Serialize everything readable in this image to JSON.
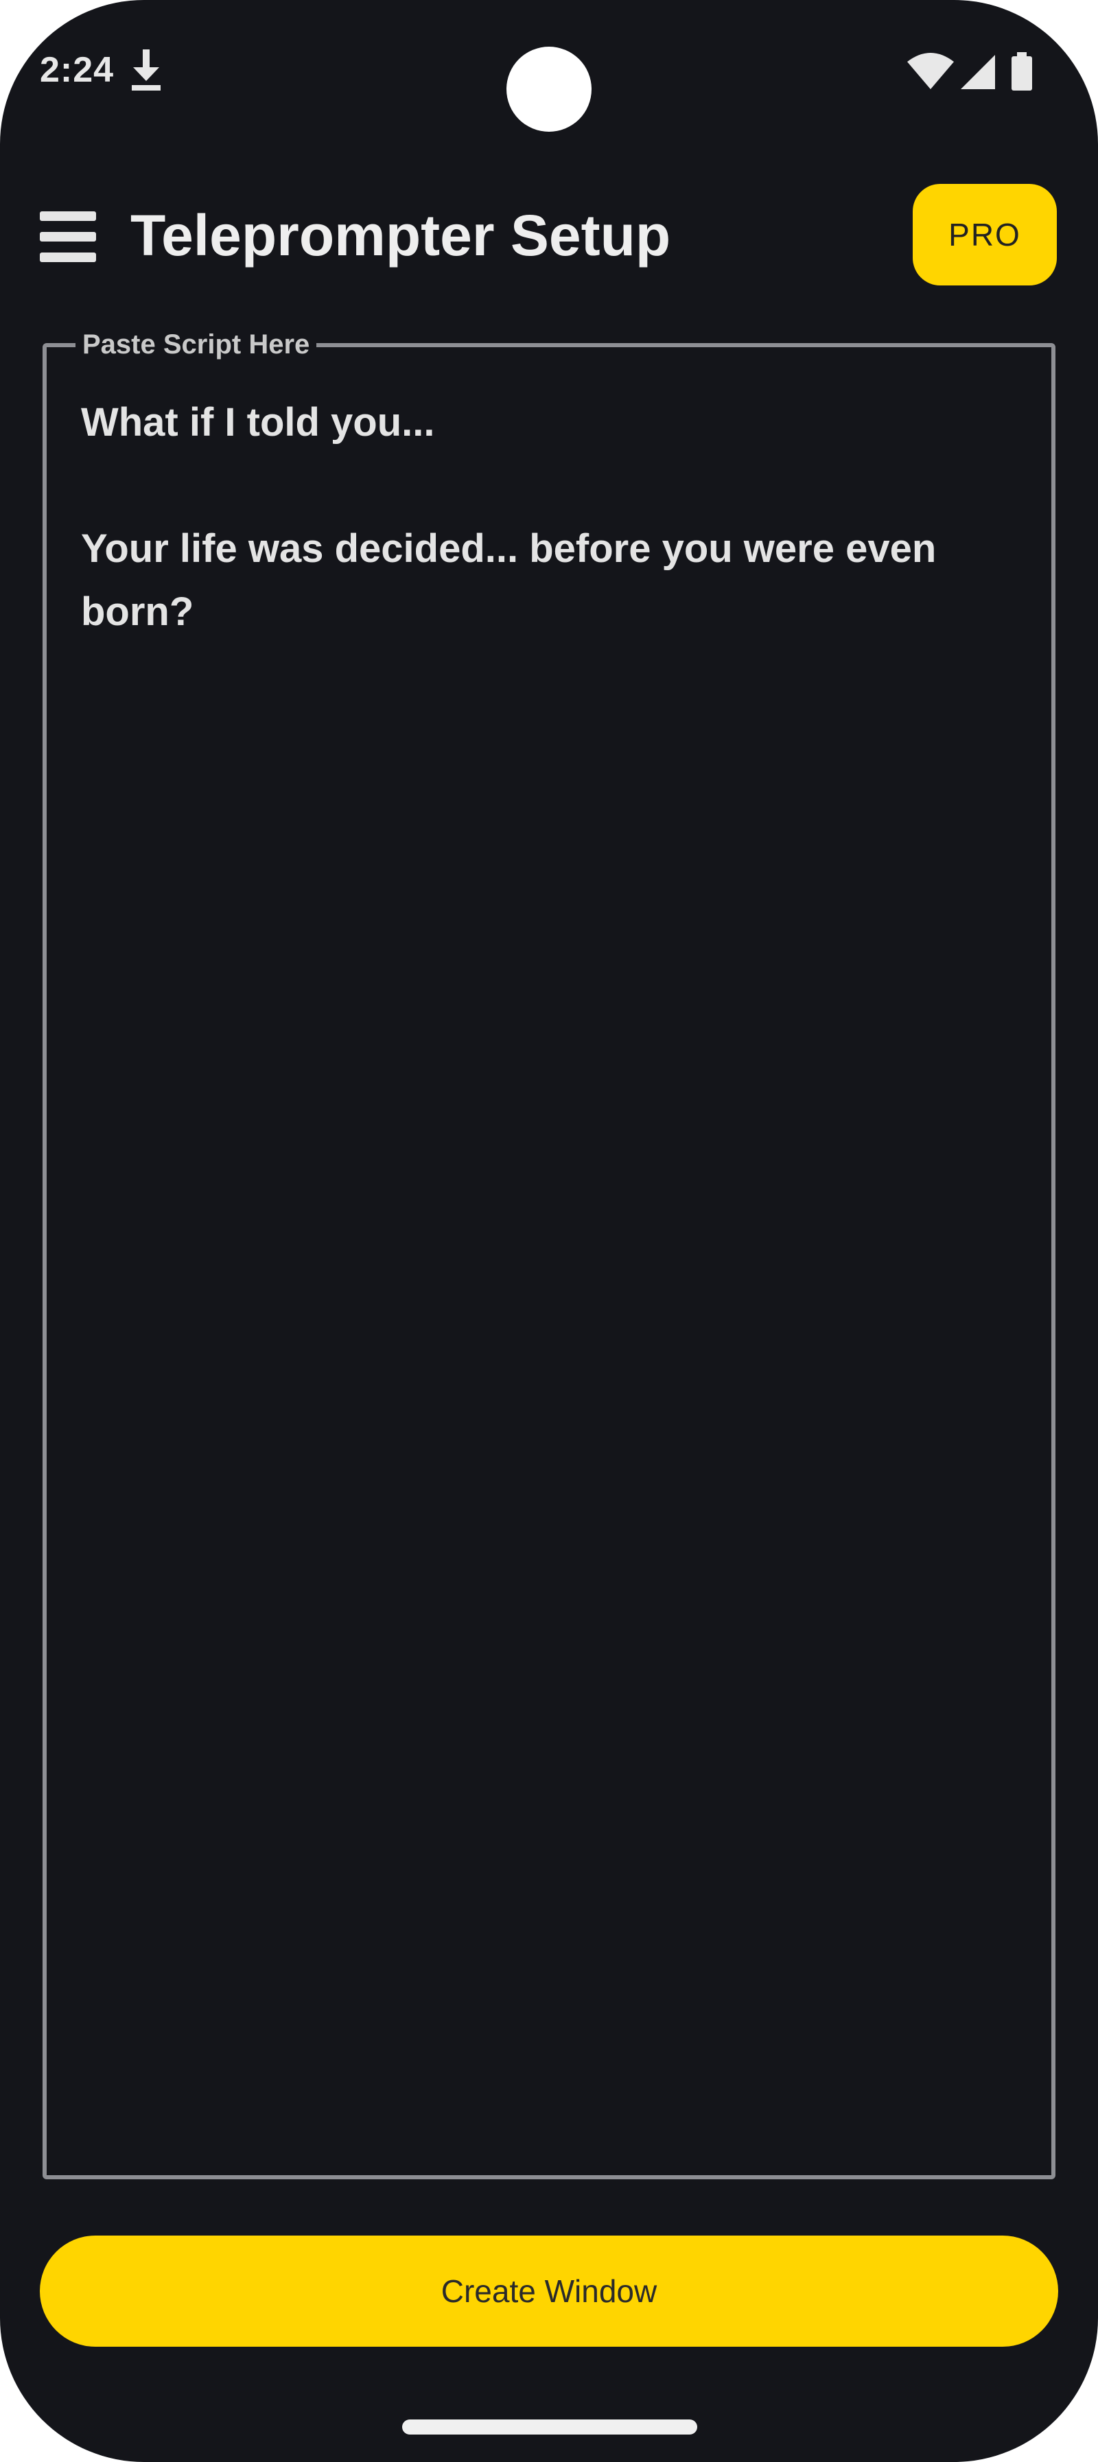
{
  "status_bar": {
    "time": "2:24",
    "icons": [
      "download-icon",
      "wifi-icon",
      "signal-icon",
      "battery-icon"
    ]
  },
  "app_bar": {
    "menu_icon": "menu-icon",
    "title": "Teleprompter Setup",
    "pro_label": "PRO"
  },
  "script_field": {
    "label": "Paste Script Here",
    "value": "What if I told you...\n\nYour life was decided... before you were even born?"
  },
  "actions": {
    "create_window_label": "Create Window"
  },
  "colors": {
    "background": "#14151a",
    "accent": "#ffd500",
    "text": "#e4e4e4",
    "border": "#8e8f94"
  }
}
